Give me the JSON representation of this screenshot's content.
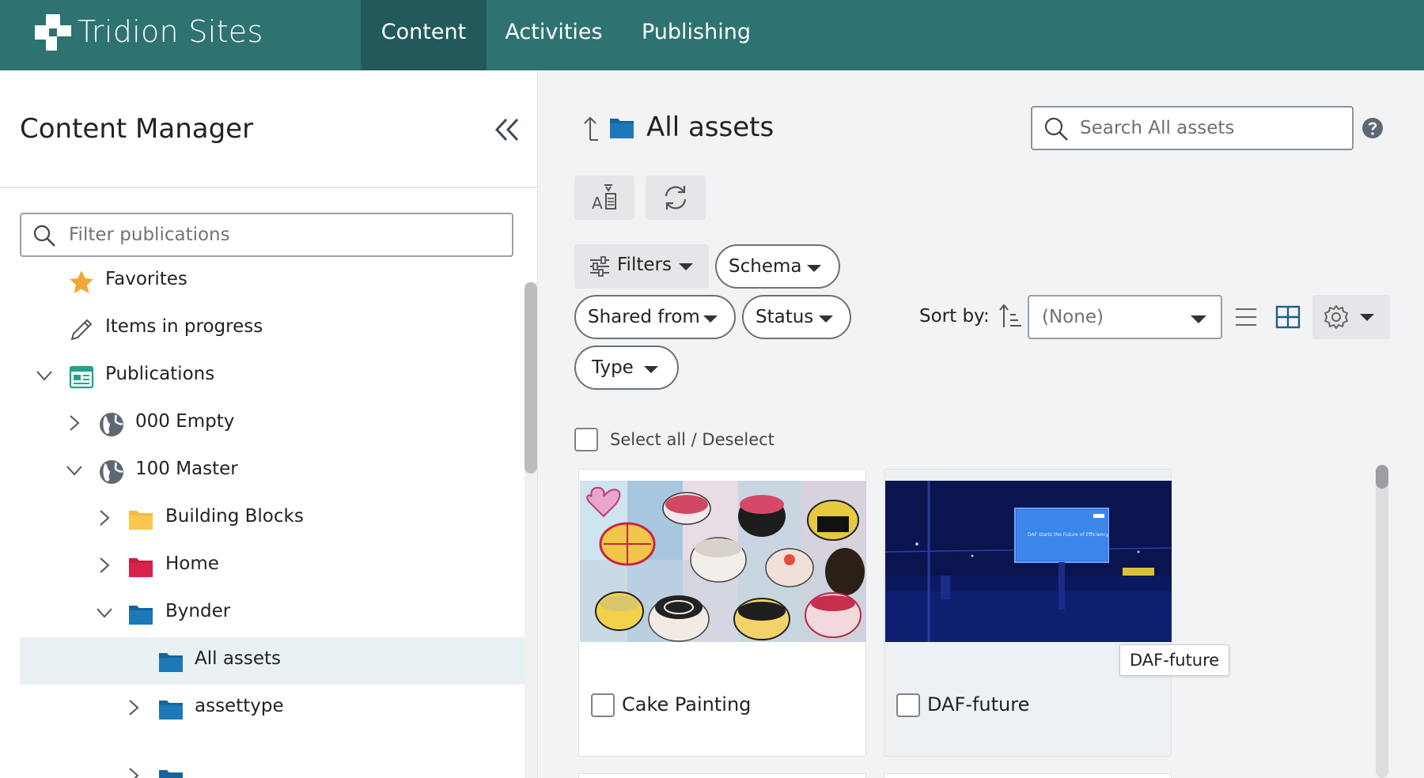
{
  "header": {
    "brand": "Tridion Sites",
    "nav": [
      {
        "label": "Content",
        "active": true
      },
      {
        "label": "Activities",
        "active": false
      },
      {
        "label": "Publishing",
        "active": false
      }
    ]
  },
  "sidebar": {
    "title": "Content Manager",
    "filter_placeholder": "Filter publications",
    "tree": [
      {
        "label": "Favorites",
        "icon": "star-icon"
      },
      {
        "label": "Items in progress",
        "icon": "pencil-icon"
      },
      {
        "label": "Publications",
        "icon": "publications-icon",
        "expanded": true
      },
      {
        "label": "000 Empty",
        "icon": "globe-icon",
        "expanded": false
      },
      {
        "label": "100 Master",
        "icon": "globe-icon",
        "expanded": true
      },
      {
        "label": "Building Blocks",
        "icon": "folder-icon",
        "expanded": false
      },
      {
        "label": "Home",
        "icon": "folder-icon",
        "expanded": false
      },
      {
        "label": "Bynder",
        "icon": "folder-icon",
        "expanded": true
      },
      {
        "label": "All assets",
        "icon": "folder-icon",
        "selected": true
      },
      {
        "label": "assettype",
        "icon": "folder-icon",
        "expanded": false
      }
    ]
  },
  "main": {
    "title": "All assets",
    "search_placeholder": "Search All assets",
    "filters": [
      {
        "label": "Filters"
      },
      {
        "label": "Schema"
      },
      {
        "label": "Shared from"
      },
      {
        "label": "Status"
      },
      {
        "label": "Type"
      }
    ],
    "sort_label": "Sort by:",
    "sort_value": "(None)",
    "select_all_label": "Select all / Deselect",
    "items": [
      {
        "title": "Cake Painting"
      },
      {
        "title": "DAF-future"
      }
    ],
    "tooltip": "DAF-future",
    "billboard_text": "DAF starts the Future of Efficiency"
  },
  "colors": {
    "header_bg": "#2e7272",
    "header_active_bg": "#22595a",
    "folder_blue": "#1c78b8",
    "folder_yellow": "#f6b93b",
    "folder_red": "#d6234b",
    "star": "#f4a533",
    "publications_green": "#22a38a",
    "selected_row": "#e9f1f2"
  }
}
